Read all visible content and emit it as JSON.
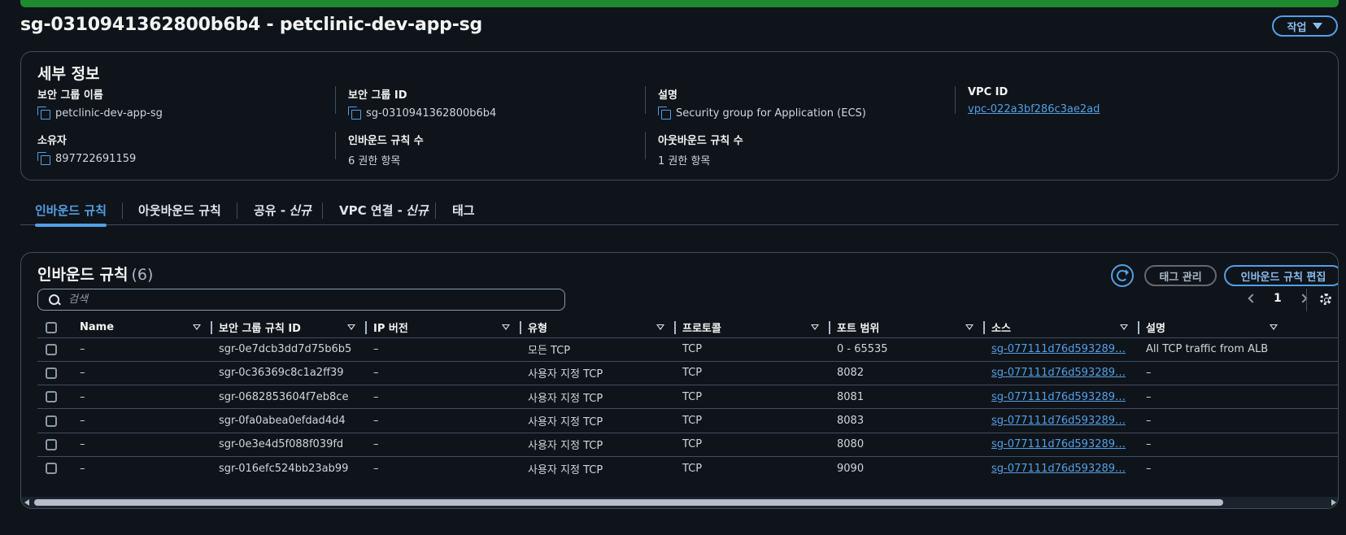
{
  "header": {
    "title": "sg-0310941362800b6b4 - petclinic-dev-app-sg",
    "actions_label": "작업"
  },
  "details": {
    "heading": "세부 정보",
    "fields": [
      {
        "label": "보안 그룹 이름",
        "value": "petclinic-dev-app-sg"
      },
      {
        "label": "보안 그룹 ID",
        "value": "sg-0310941362800b6b4"
      },
      {
        "label": "설명",
        "value": "Security group for Application (ECS)"
      },
      {
        "label": "VPC ID",
        "value": "vpc-022a3bf286c3ae2ad"
      },
      {
        "label": "소유자",
        "value": "897722691159"
      },
      {
        "label": "인바운드 규칙 수",
        "value": "6 권한 항목"
      },
      {
        "label": "아웃바운드 규칙 수",
        "value": "1 권한 항목"
      }
    ]
  },
  "tabs": [
    {
      "label": "인바운드 규칙",
      "suffix": ""
    },
    {
      "label": "아웃바운드 규칙",
      "suffix": ""
    },
    {
      "label": "공유 -",
      "suffix": "신규"
    },
    {
      "label": "VPC 연결 -",
      "suffix": "신규"
    },
    {
      "label": "태그",
      "suffix": ""
    }
  ],
  "rules_panel": {
    "heading": "인바운드 규칙",
    "count": "(6)",
    "manage_tags_label": "태그 관리",
    "edit_rules_label": "인바운드 규칙 편집",
    "search_placeholder": "검색",
    "page": "1",
    "columns": [
      "Name",
      "보안 그룹 규칙 ID",
      "IP 버전",
      "유형",
      "프로토콜",
      "포트 범위",
      "소스",
      "설명"
    ],
    "rows": [
      [
        "–",
        "sgr-0e7dcb3dd7d75b6b5",
        "–",
        "모든 TCP",
        "TCP",
        "0 - 65535",
        "sg-077111d76d593289…",
        "All TCP traffic from ALB"
      ],
      [
        "–",
        "sgr-0c36369c8c1a2ff39",
        "–",
        "사용자 지정 TCP",
        "TCP",
        "8082",
        "sg-077111d76d593289…",
        "–"
      ],
      [
        "–",
        "sgr-0682853604f7eb8ce",
        "–",
        "사용자 지정 TCP",
        "TCP",
        "8081",
        "sg-077111d76d593289…",
        "–"
      ],
      [
        "–",
        "sgr-0fa0abea0efdad4d4",
        "–",
        "사용자 지정 TCP",
        "TCP",
        "8083",
        "sg-077111d76d593289…",
        "–"
      ],
      [
        "–",
        "sgr-0e3e4d5f088f039fd",
        "–",
        "사용자 지정 TCP",
        "TCP",
        "8080",
        "sg-077111d76d593289…",
        "–"
      ],
      [
        "–",
        "sgr-016efc524bb23ab99",
        "–",
        "사용자 지정 TCP",
        "TCP",
        "9090",
        "sg-077111d76d593289…",
        "–"
      ]
    ]
  },
  "colors": {
    "accent": "#539fe5",
    "success_bar": "#1e8a2e",
    "background": "#0f141a",
    "border": "#414d5c"
  }
}
